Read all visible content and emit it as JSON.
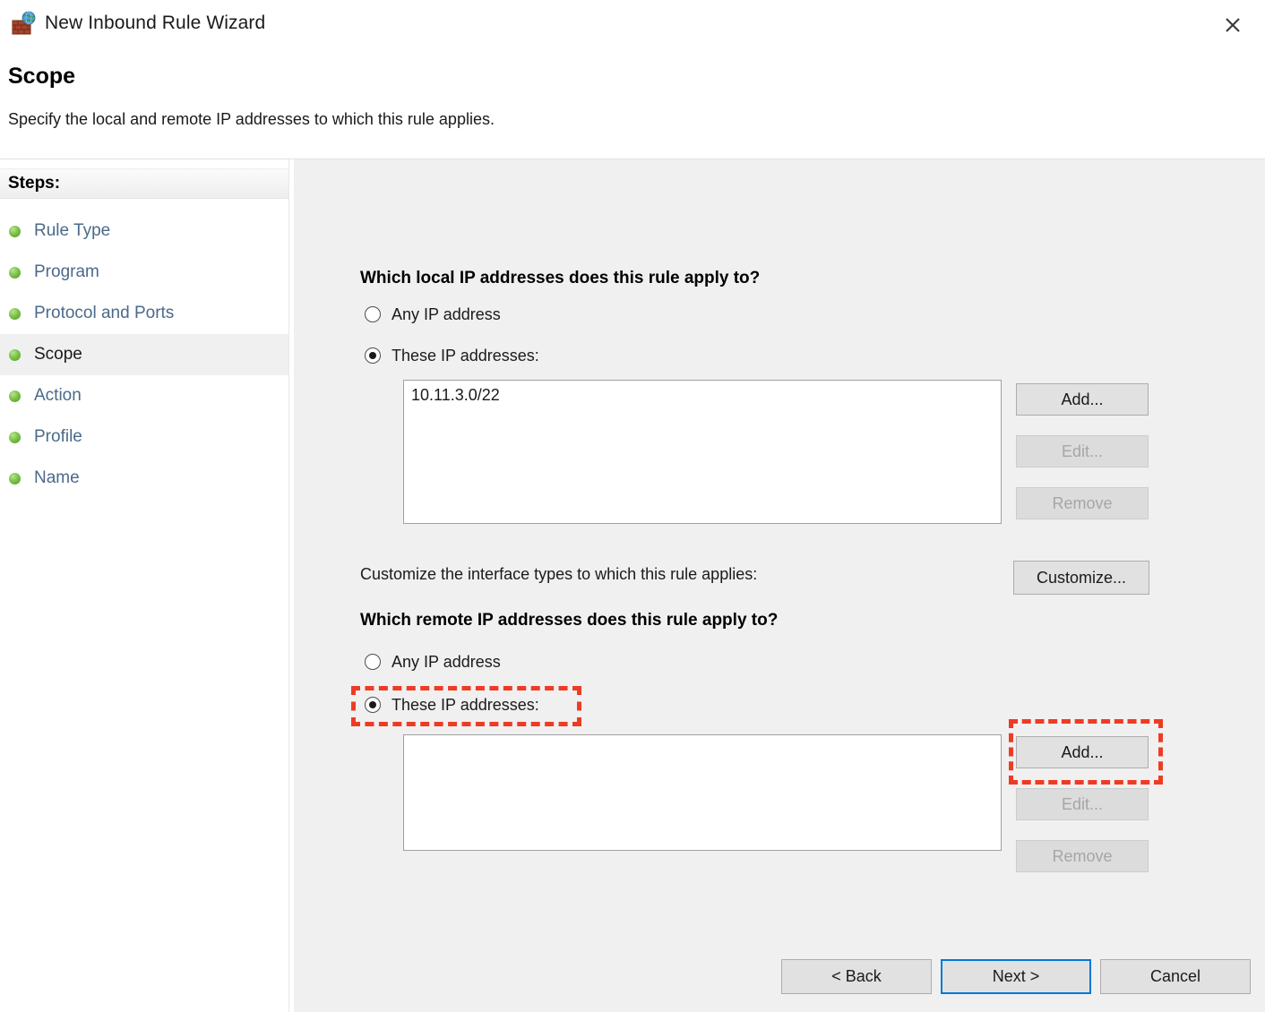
{
  "window": {
    "title": "New Inbound Rule Wizard",
    "icon": "firewall-globe-icon",
    "close_label": "✕"
  },
  "header": {
    "page_title": "Scope",
    "subtitle": "Specify the local and remote IP addresses to which this rule applies."
  },
  "sidebar": {
    "header_label": "Steps:",
    "items": [
      {
        "label": "Rule Type",
        "active": false
      },
      {
        "label": "Program",
        "active": false
      },
      {
        "label": "Protocol and Ports",
        "active": false
      },
      {
        "label": "Scope",
        "active": true
      },
      {
        "label": "Action",
        "active": false
      },
      {
        "label": "Profile",
        "active": false
      },
      {
        "label": "Name",
        "active": false
      }
    ]
  },
  "main": {
    "local": {
      "question": "Which local IP addresses does this rule apply to?",
      "any_label": "Any IP address",
      "these_label": "These IP addresses:",
      "selected": "these",
      "list_items": [
        "10.11.3.0/22"
      ],
      "add_label": "Add...",
      "edit_label": "Edit...",
      "remove_label": "Remove"
    },
    "interface": {
      "text": "Customize the interface types to which this rule applies:",
      "customize_label": "Customize..."
    },
    "remote": {
      "question": "Which remote IP addresses does this rule apply to?",
      "any_label": "Any IP address",
      "these_label": "These IP addresses:",
      "selected": "these",
      "list_items": [],
      "add_label": "Add...",
      "edit_label": "Edit...",
      "remove_label": "Remove"
    }
  },
  "footer": {
    "back_label": "< Back",
    "next_label": "Next >",
    "cancel_label": "Cancel"
  },
  "annotations": {
    "highlight_color": "#ee3b24",
    "targets": [
      "remote-these-ip-radio",
      "remote-add-button"
    ]
  }
}
